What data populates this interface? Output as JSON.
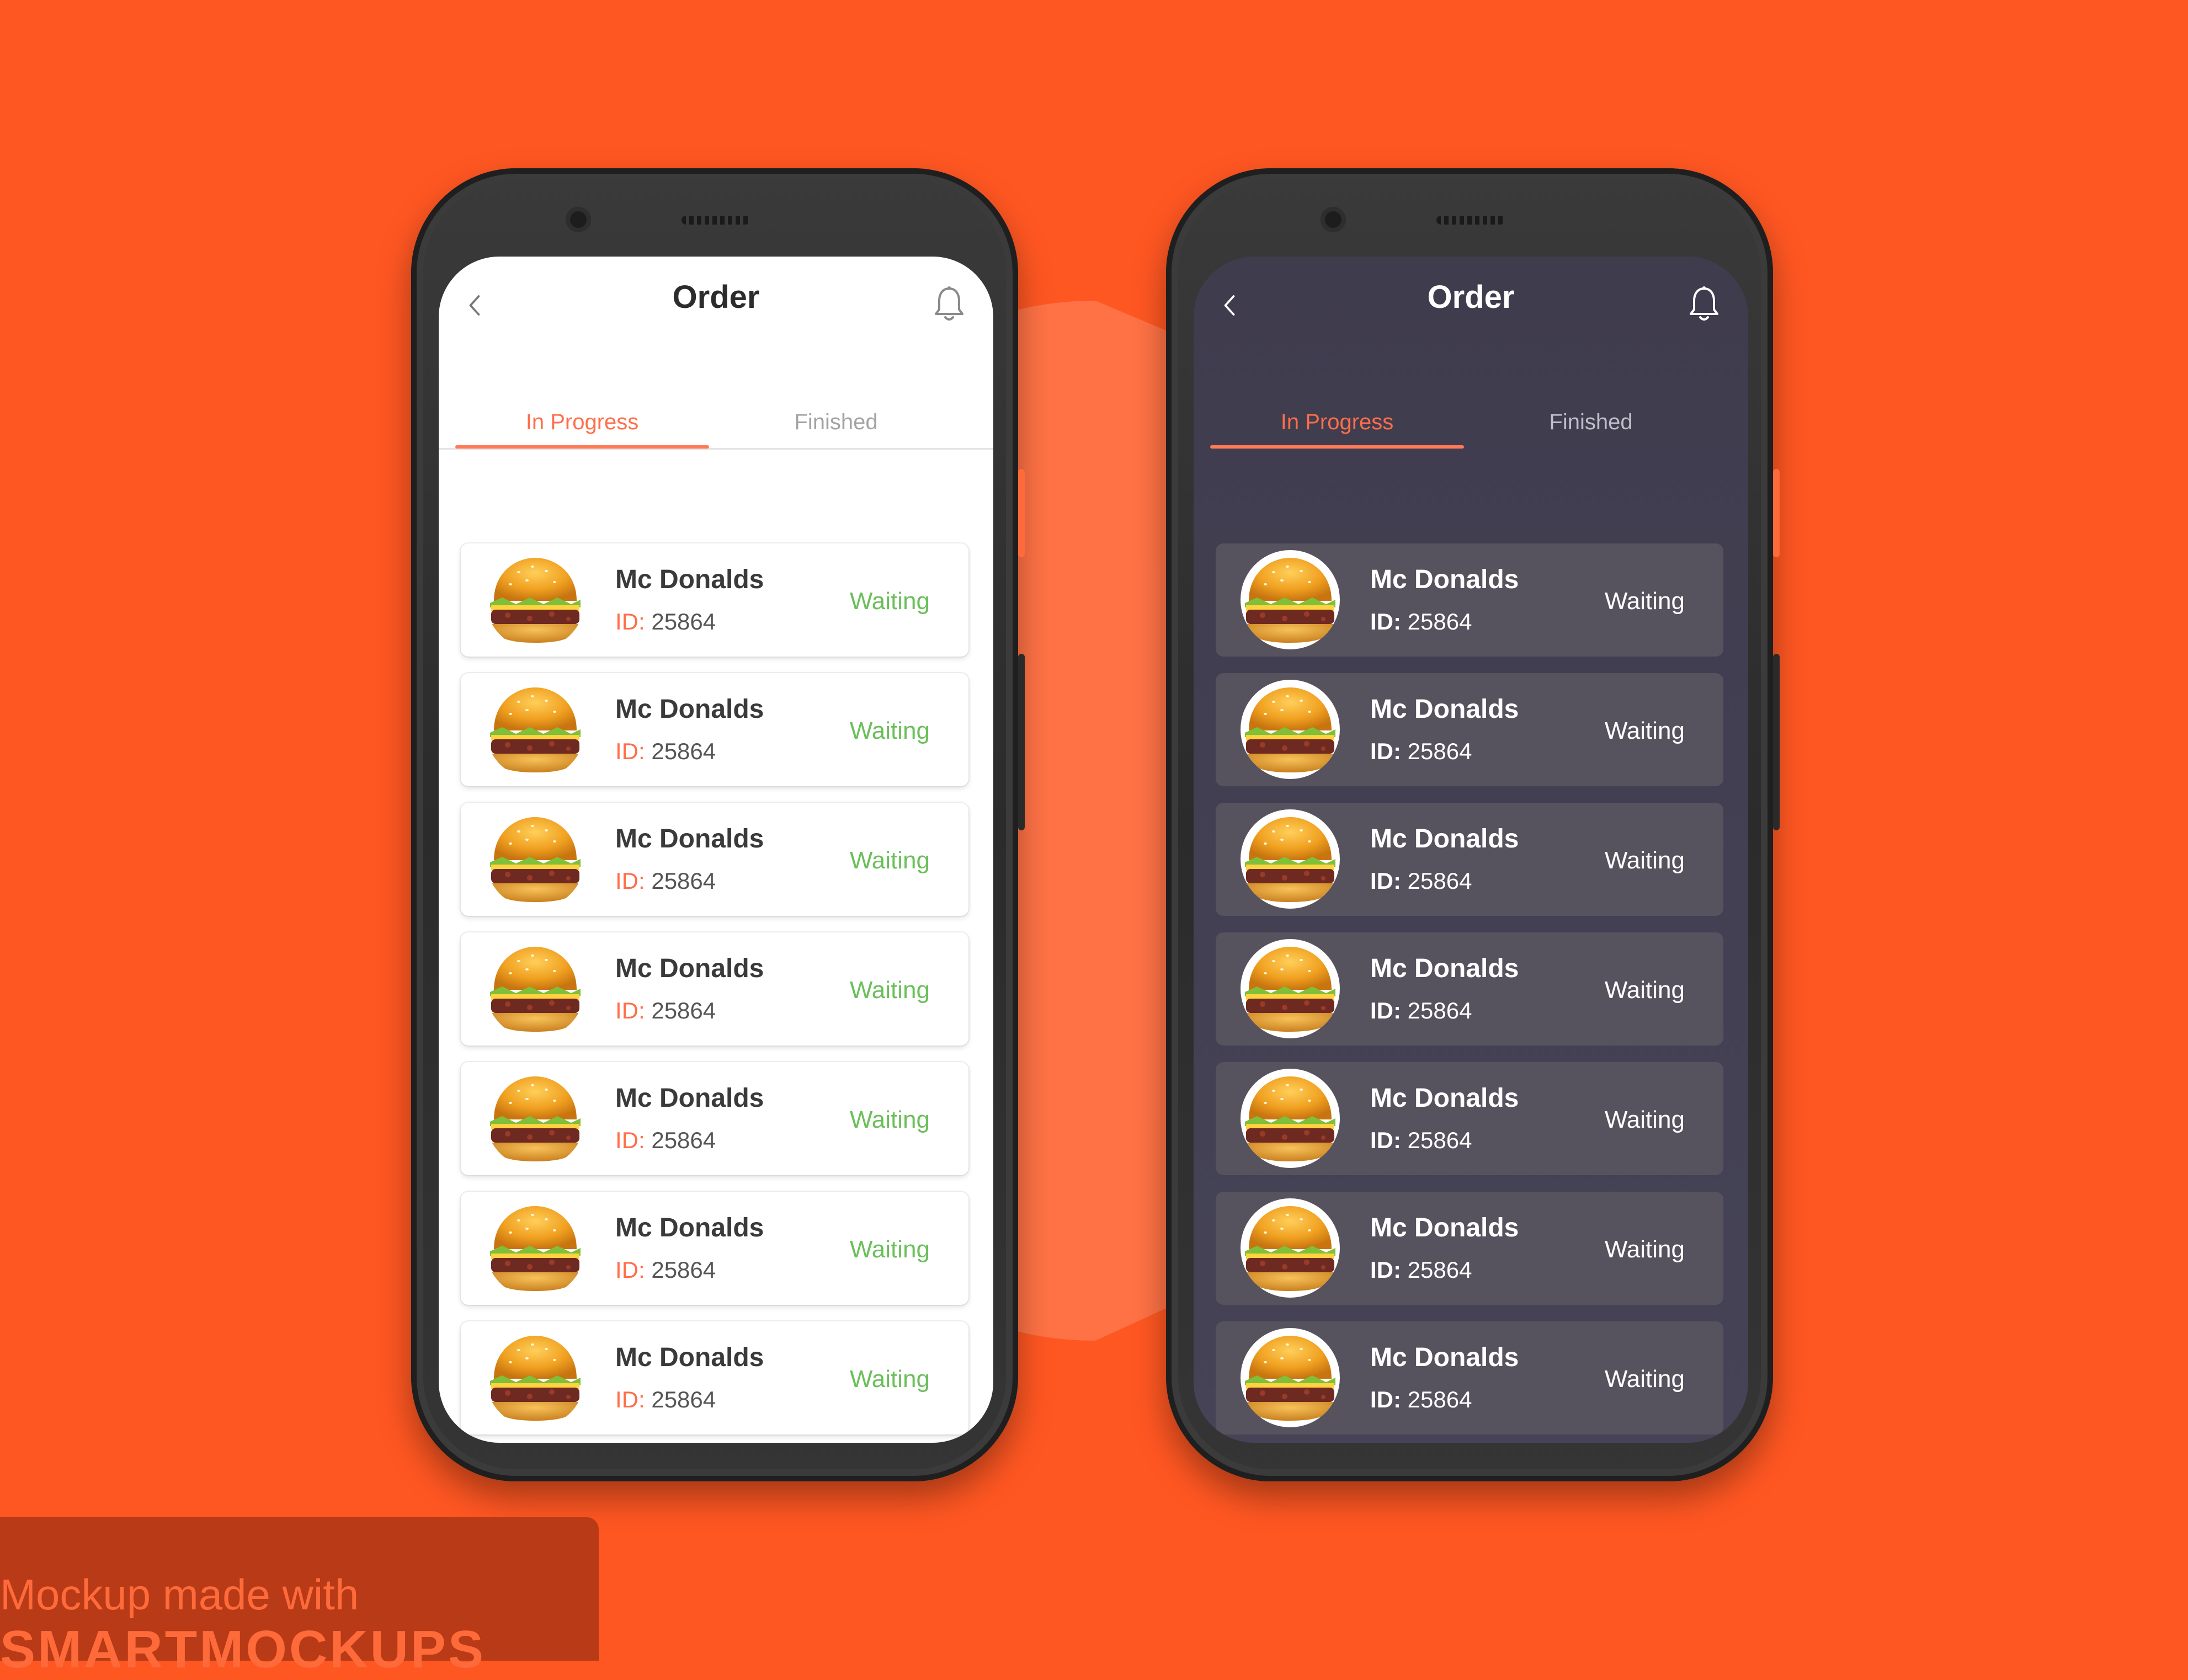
{
  "colors": {
    "background": "#ff5722",
    "accent": "#ff6e4a",
    "status_green": "#6bbf5a",
    "dark_screen": "#3f3c4e",
    "dark_card": "#56535f"
  },
  "phones": [
    {
      "theme": "light",
      "header": {
        "title": "Order",
        "back_icon": "chevron-left-icon",
        "bell_icon": "bell-icon"
      },
      "tabs": [
        {
          "label": "In Progress",
          "active": true
        },
        {
          "label": "Finished",
          "active": false
        }
      ],
      "orders": [
        {
          "name": "Mc Donalds",
          "id_label": "ID:",
          "id": "25864",
          "status": "Waiting"
        },
        {
          "name": "Mc Donalds",
          "id_label": "ID:",
          "id": "25864",
          "status": "Waiting"
        },
        {
          "name": "Mc Donalds",
          "id_label": "ID:",
          "id": "25864",
          "status": "Waiting"
        },
        {
          "name": "Mc Donalds",
          "id_label": "ID:",
          "id": "25864",
          "status": "Waiting"
        },
        {
          "name": "Mc Donalds",
          "id_label": "ID:",
          "id": "25864",
          "status": "Waiting"
        },
        {
          "name": "Mc Donalds",
          "id_label": "ID:",
          "id": "25864",
          "status": "Waiting"
        },
        {
          "name": "Mc Donalds",
          "id_label": "ID:",
          "id": "25864",
          "status": "Waiting"
        }
      ]
    },
    {
      "theme": "dark",
      "header": {
        "title": "Order",
        "back_icon": "chevron-left-icon",
        "bell_icon": "bell-icon"
      },
      "tabs": [
        {
          "label": "In Progress",
          "active": true
        },
        {
          "label": "Finished",
          "active": false
        }
      ],
      "orders": [
        {
          "name": "Mc Donalds",
          "id_label": "ID:",
          "id": "25864",
          "status": "Waiting"
        },
        {
          "name": "Mc Donalds",
          "id_label": "ID:",
          "id": "25864",
          "status": "Waiting"
        },
        {
          "name": "Mc Donalds",
          "id_label": "ID:",
          "id": "25864",
          "status": "Waiting"
        },
        {
          "name": "Mc Donalds",
          "id_label": "ID:",
          "id": "25864",
          "status": "Waiting"
        },
        {
          "name": "Mc Donalds",
          "id_label": "ID:",
          "id": "25864",
          "status": "Waiting"
        },
        {
          "name": "Mc Donalds",
          "id_label": "ID:",
          "id": "25864",
          "status": "Waiting"
        },
        {
          "name": "Mc Donalds",
          "id_label": "ID:",
          "id": "25864",
          "status": "Waiting"
        }
      ]
    }
  ],
  "watermark": {
    "line1": "Mockup made with",
    "line2": "SMARTMOCKUPS"
  }
}
